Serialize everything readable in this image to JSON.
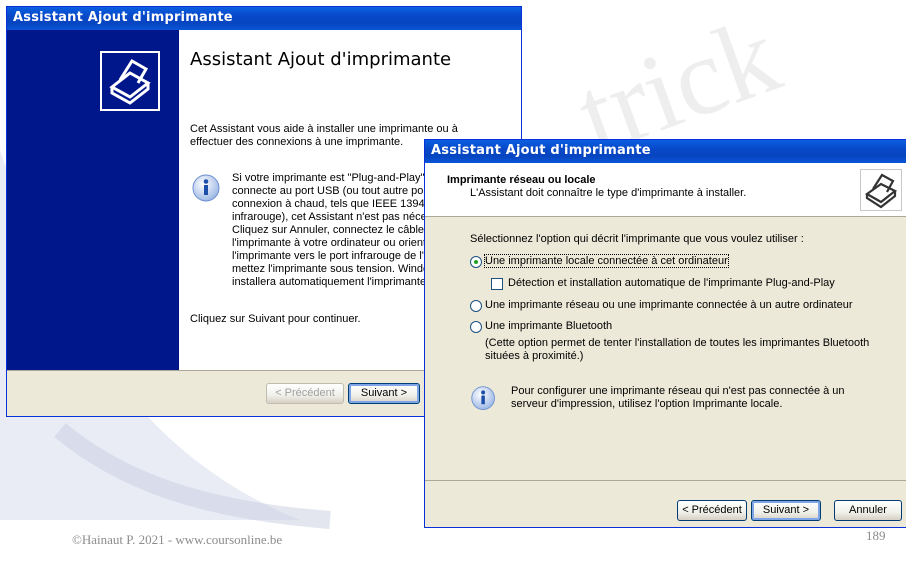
{
  "footer": {
    "copyright": "©Hainaut P. 2021 - www.coursonline.be",
    "page_number": "189"
  },
  "window1": {
    "title": "Assistant Ajout d'imprimante",
    "heading": "Assistant Ajout d'imprimante",
    "intro_line1": "Cet Assistant vous aide à installer une imprimante ou à",
    "intro_line2": "effectuer des connexions à une imprimante.",
    "info_lines": [
      "Si votre imprimante est \"Plug-and-Play\" e",
      "connecte au port USB (ou tout autre por",
      "connexion à chaud, tels que IEEE 1394",
      "infrarouge), cet Assistant n'est pas néce",
      "Cliquez sur Annuler, connectez le câble",
      "l'imprimante à votre ordinateur ou oriente",
      "l'imprimante vers le port infrarouge de l'o",
      "mettez l'imprimante sous tension. Windo",
      "installera automatiquement l'imprimante."
    ],
    "continue_text": "Cliquez sur Suivant pour continuer.",
    "back_button": "< Précédent",
    "next_button": "Suivant >",
    "info_icon": "info-icon",
    "logo_icon": "printer-wizard-icon"
  },
  "window2": {
    "title": "Assistant Ajout d'imprimante",
    "header_title": "Imprimante réseau ou locale",
    "header_subtitle": "L'Assistant doit connaître le type d'imprimante à installer.",
    "prompt": "Sélectionnez l'option qui décrit l'imprimante que vous voulez utiliser :",
    "option_local": "Une imprimante locale connectée à cet ordinateur",
    "option_autodetect": "Détection et installation automatique de l'imprimante Plug-and-Play",
    "option_network": "Une imprimante réseau ou une imprimante connectée à un autre ordinateur",
    "option_bluetooth": "Une imprimante Bluetooth",
    "bluetooth_note_line1": "(Cette option permet de tenter l'installation de toutes les imprimantes Bluetooth",
    "bluetooth_note_line2": "situées à proximité.)",
    "info_line1": "Pour configurer une imprimante réseau qui n'est pas connectée à un",
    "info_line2": "serveur d'impression, utilisez l'option Imprimante locale.",
    "back_button": "< Précédent",
    "next_button": "Suivant >",
    "cancel_button": "Annuler",
    "selected_option": "option_local"
  }
}
